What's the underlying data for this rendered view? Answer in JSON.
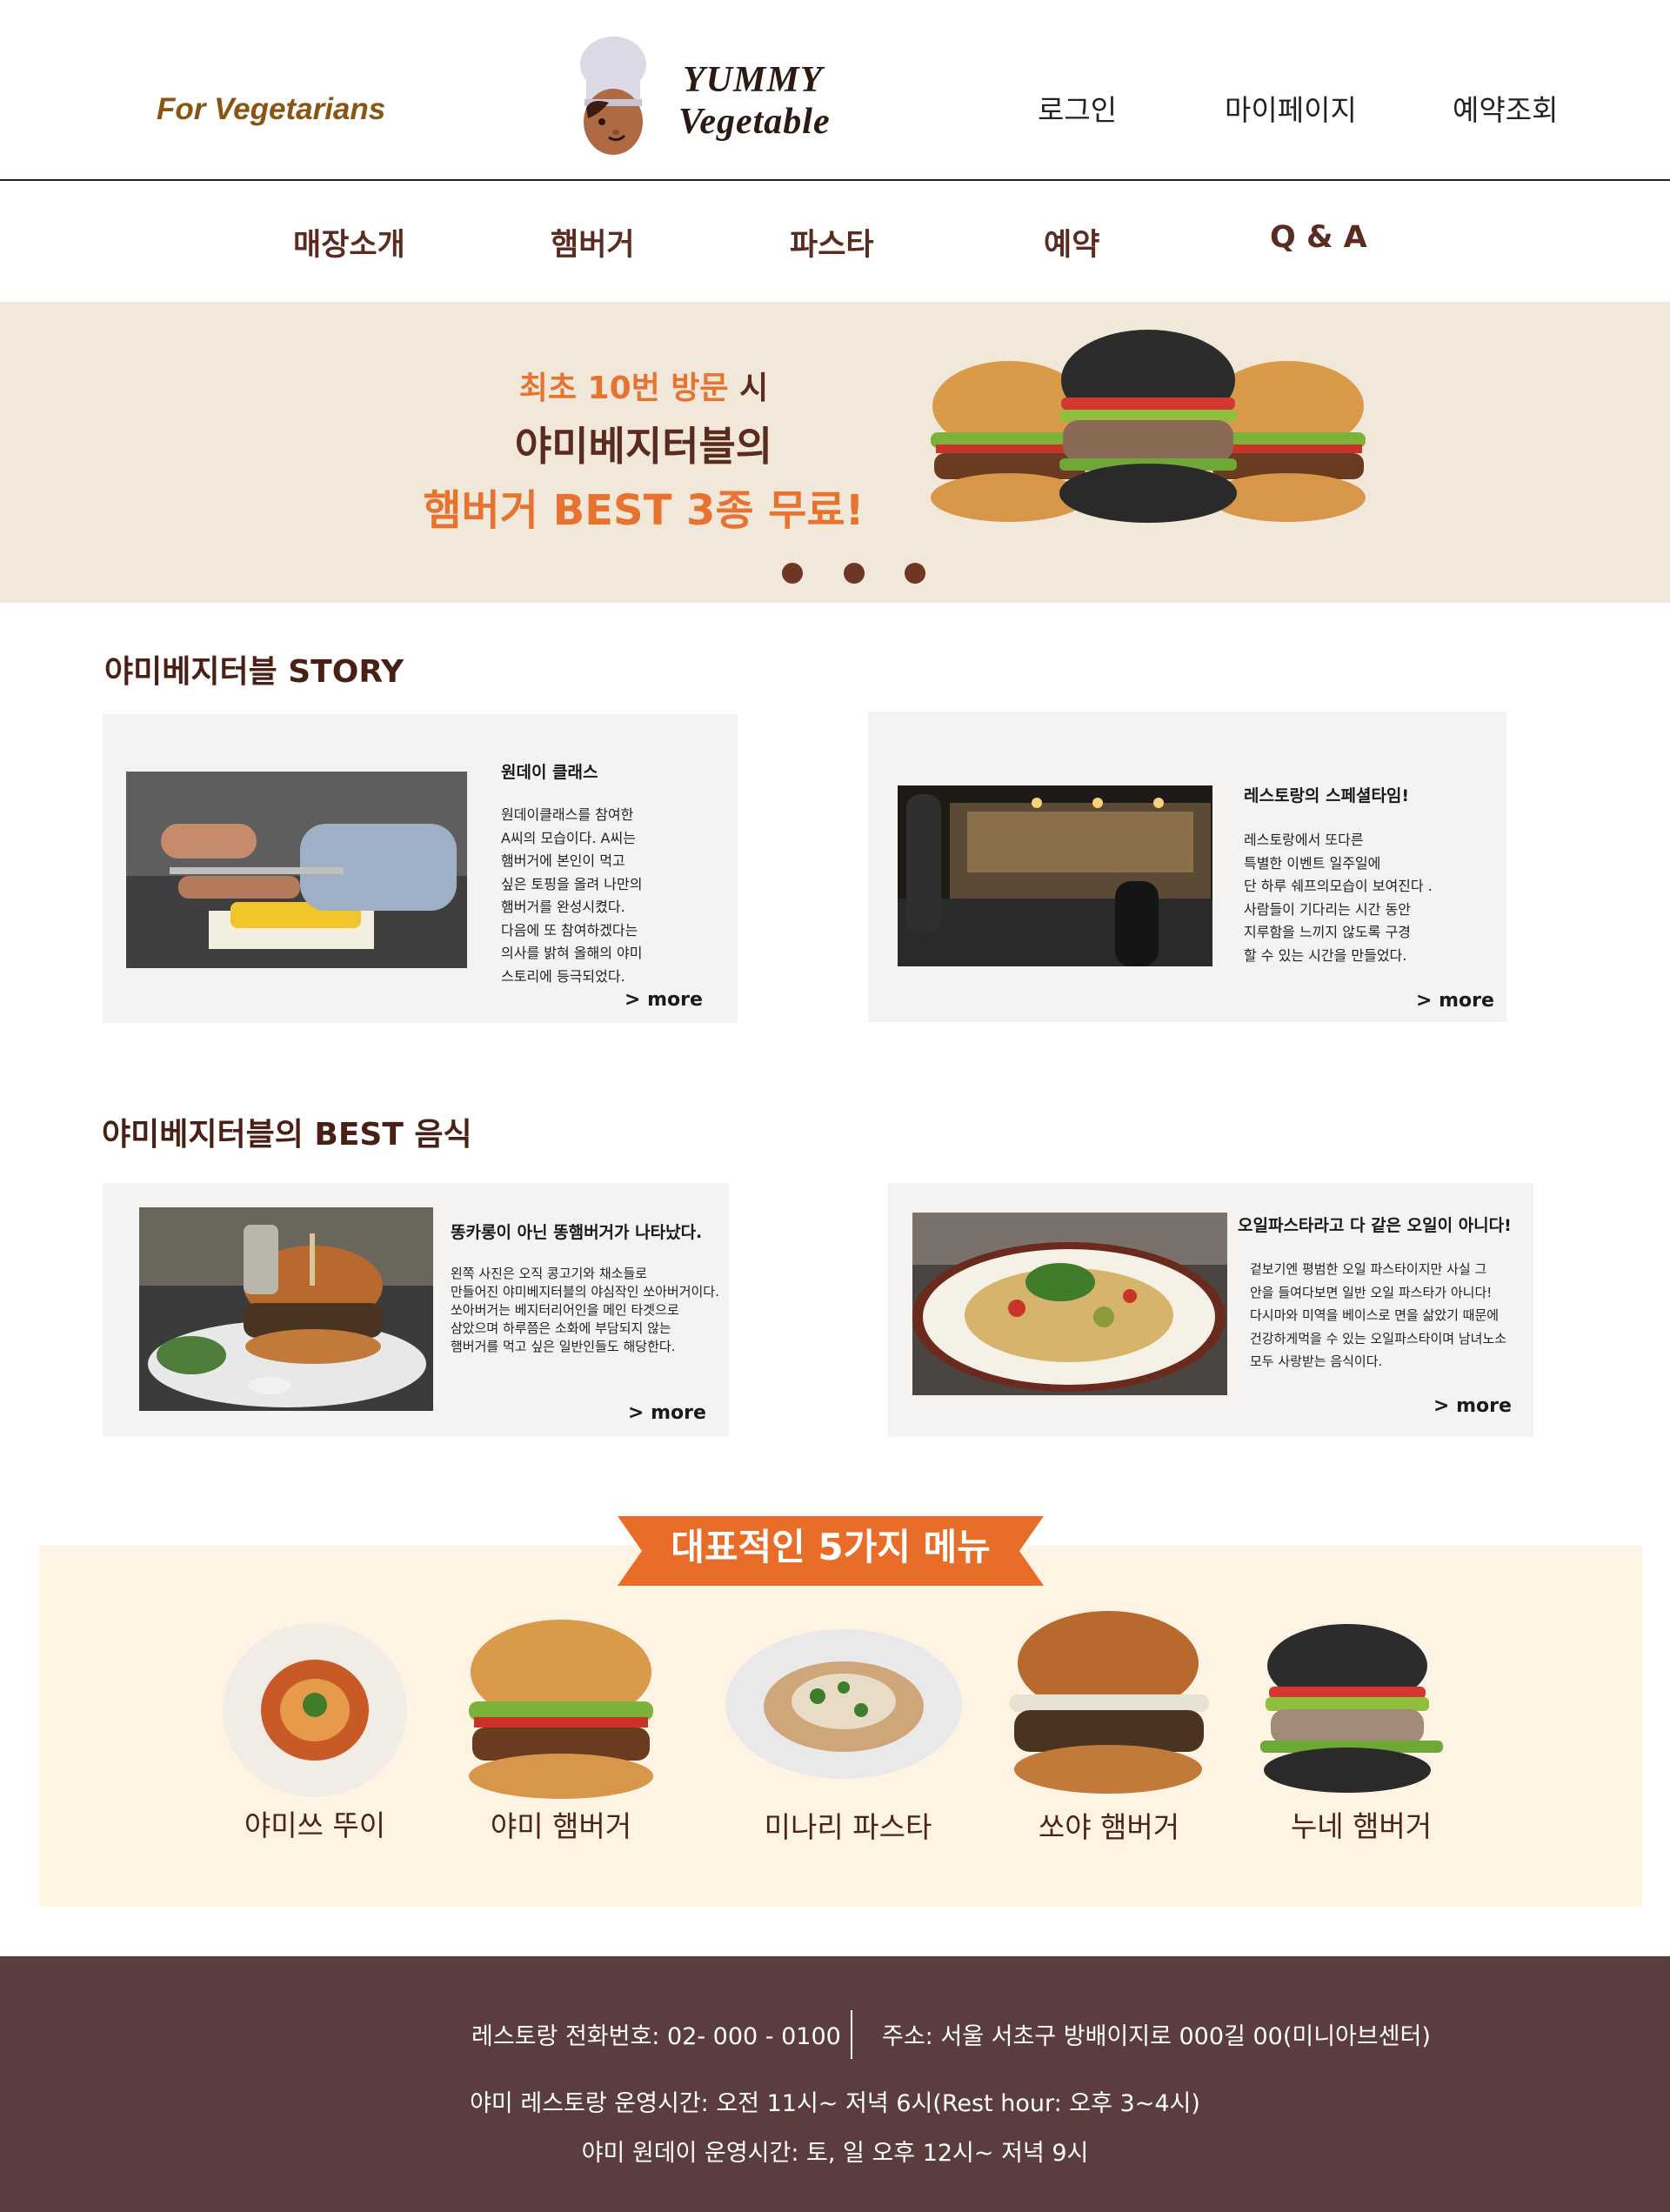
{
  "header": {
    "tagline": "For Vegetarians",
    "logo_line1": "YUMMY",
    "logo_line2": "Vegetable",
    "util_links": [
      "로그인",
      "마이페이지",
      "예약조회"
    ]
  },
  "nav": {
    "items": [
      "매장소개",
      "햄버거",
      "파스타",
      "예약",
      "Q & A"
    ]
  },
  "hero": {
    "line1_highlight": "최초 10번 방문",
    "line1_rest": " 시",
    "line2": "야미베지터블의",
    "line3": "햄버거  BEST 3종 무료!",
    "slide_count": 3
  },
  "story": {
    "title": "야미베지터블 STORY",
    "cards": [
      {
        "heading": "원데이 클래스",
        "body": "원데이클래스를 참여한\nA씨의 모습이다.  A씨는\n햄버거에 본인이 먹고\n싶은 토핑을 올려 나만의\n햄버거를 완성시켰다.\n다음에 또 참여하겠다는\n의사를 밝혀 올해의 야미\n스토리에 등극되었다.",
        "more": "> more"
      },
      {
        "heading": "레스토랑의 스페셜타임!",
        "body": "레스토랑에서 또다른\n특별한 이벤트  일주일에\n단 하루 쉐프의모습이 보여진다 .\n사람들이 기다리는 시간 동안\n지루함을 느끼지 않도록 구경\n할 수 있는 시간을 만들었다.",
        "more": "> more"
      }
    ]
  },
  "best": {
    "title": "야미베지터블의 BEST 음식",
    "cards": [
      {
        "heading": "똥카롱이 아닌 똥햄버거가 나타났다.",
        "body": "  왼쪽 사진은 오직 콩고기와 채소들로\n만들어진 야미베지터블의 야심작인 쏘아버거이다.\n쏘아버거는 베지터리어인을 메인 타겟으로\n삼았으며 하루쯤은 소화에 부담되지 않는\n햄버거를 먹고 싶은 일반인들도 해당한다.",
        "more": "> more"
      },
      {
        "heading": "오일파스타라고 다 같은 오일이 아니다!",
        "body": "  겉보기엔 평범한 오일 파스타이지만 사실 그\n안을 들여다보면 일반 오일 파스타가 아니다!\n다시마와 미역을 베이스로 면을 삶았기 때문에\n건강하게먹을 수 있는 오일파스타이며 남녀노소\n모두 사랑받는 음식이다.",
        "more": "> more"
      }
    ]
  },
  "menu": {
    "title": "대표적인 5가지 메뉴",
    "items": [
      "야미쓰 뚜이",
      "야미 햄버거",
      "미나리 파스타",
      "쏘야 햄버거",
      "누네 햄버거"
    ]
  },
  "footer": {
    "phone": "레스토랑 전화번호: 02- 000 - 0100",
    "address": "주소: 서울 서초구 방배이지로 000길 00(미니아브센터)",
    "hours": "야미 레스토랑 운영시간: 오전 11시~ 저녁 6시(Rest hour: 오후 3~4시)",
    "class_hours": "야미 원데이 운영시간: 토, 일 오후 12시~ 저녁 9시"
  },
  "colors": {
    "accent_orange": "#e8722f",
    "brand_brown": "#5a2b1e",
    "hero_bg": "#f1e8da",
    "menu_bg": "#fff4e3",
    "footer_bg": "#5c3d3d",
    "card_bg": "#f5f2f2"
  }
}
